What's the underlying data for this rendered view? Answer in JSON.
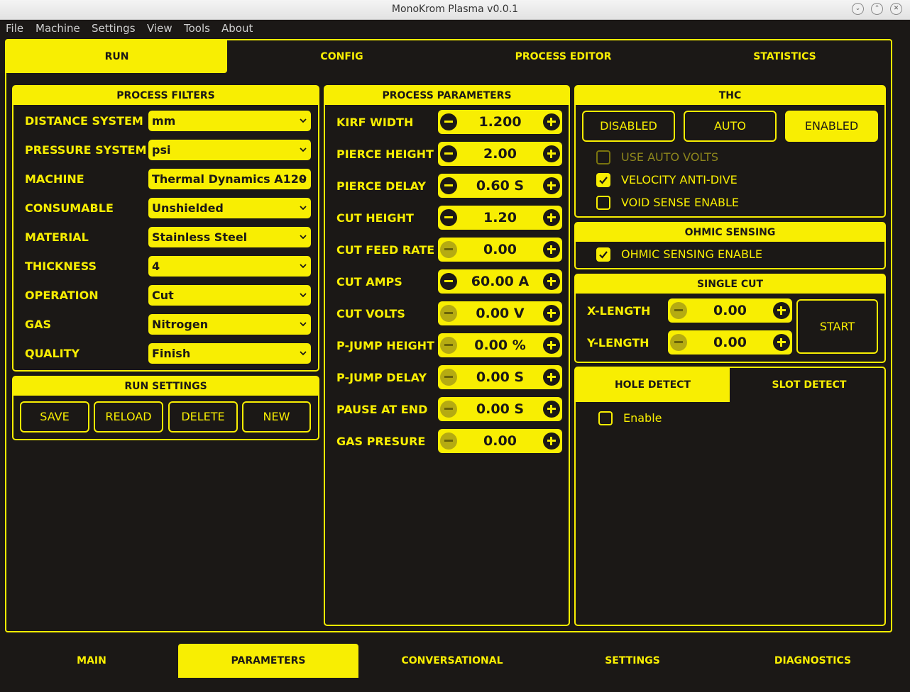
{
  "window": {
    "title": "MonoKrom Plasma v0.0.1"
  },
  "menu": [
    "File",
    "Machine",
    "Settings",
    "View",
    "Tools",
    "About"
  ],
  "top_tabs": [
    {
      "label": "RUN",
      "active": true
    },
    {
      "label": "CONFIG",
      "active": false
    },
    {
      "label": "PROCESS EDITOR",
      "active": false
    },
    {
      "label": "STATISTICS",
      "active": false
    }
  ],
  "process_filters": {
    "title": "PROCESS FILTERS",
    "fields": [
      {
        "label": "DISTANCE SYSTEM",
        "value": "mm"
      },
      {
        "label": "PRESSURE SYSTEM",
        "value": "psi"
      },
      {
        "label": "MACHINE",
        "value": "Thermal Dynamics A120"
      },
      {
        "label": "CONSUMABLE",
        "value": "Unshielded"
      },
      {
        "label": "MATERIAL",
        "value": "Stainless Steel"
      },
      {
        "label": "THICKNESS",
        "value": "4"
      },
      {
        "label": "OPERATION",
        "value": "Cut"
      },
      {
        "label": "GAS",
        "value": "Nitrogen"
      },
      {
        "label": "QUALITY",
        "value": "Finish"
      }
    ]
  },
  "run_settings": {
    "title": "RUN SETTINGS",
    "buttons": [
      "SAVE",
      "RELOAD",
      "DELETE",
      "NEW"
    ]
  },
  "process_parameters": {
    "title": "PROCESS PARAMETERS",
    "rows": [
      {
        "label": "KIRF WIDTH",
        "value": "1.200",
        "minus_enabled": true
      },
      {
        "label": "PIERCE HEIGHT",
        "value": "2.00",
        "minus_enabled": true
      },
      {
        "label": "PIERCE DELAY",
        "value": "0.60 S",
        "minus_enabled": true
      },
      {
        "label": "CUT HEIGHT",
        "value": "1.20",
        "minus_enabled": true
      },
      {
        "label": "CUT FEED RATE",
        "value": "0.00",
        "minus_enabled": false
      },
      {
        "label": "CUT AMPS",
        "value": "60.00 A",
        "minus_enabled": true
      },
      {
        "label": "CUT VOLTS",
        "value": "0.00 V",
        "minus_enabled": false
      },
      {
        "label": "P-JUMP HEIGHT",
        "value": "0.00 %",
        "minus_enabled": false
      },
      {
        "label": "P-JUMP DELAY",
        "value": "0.00 S",
        "minus_enabled": false
      },
      {
        "label": "PAUSE AT END",
        "value": "0.00 S",
        "minus_enabled": false
      },
      {
        "label": "GAS PRESURE",
        "value": "0.00",
        "minus_enabled": false
      }
    ]
  },
  "thc": {
    "title": "THC",
    "modes": [
      {
        "label": "DISABLED",
        "selected": false
      },
      {
        "label": "AUTO",
        "selected": false
      },
      {
        "label": "ENABLED",
        "selected": true
      }
    ],
    "checks": [
      {
        "label": "USE AUTO VOLTS",
        "checked": false,
        "disabled": true
      },
      {
        "label": "VELOCITY ANTI-DIVE",
        "checked": true,
        "disabled": false
      },
      {
        "label": "VOID SENSE ENABLE",
        "checked": false,
        "disabled": false
      }
    ]
  },
  "ohmic": {
    "title": "OHMIC SENSING",
    "check": {
      "label": "OHMIC SENSING ENABLE",
      "checked": true
    }
  },
  "single_cut": {
    "title": "SINGLE CUT",
    "x_label": "X-LENGTH",
    "x_value": "0.00",
    "y_label": "Y-LENGTH",
    "y_value": "0.00",
    "start_label": "START"
  },
  "detect": {
    "tabs": [
      {
        "label": "HOLE DETECT",
        "active": true
      },
      {
        "label": "SLOT DETECT",
        "active": false
      }
    ],
    "check": {
      "label": "Enable",
      "checked": false
    }
  },
  "bottom_tabs": [
    {
      "label": "MAIN",
      "active": false
    },
    {
      "label": "PARAMETERS",
      "active": true
    },
    {
      "label": "CONVERSATIONAL",
      "active": false
    },
    {
      "label": "SETTINGS",
      "active": false
    },
    {
      "label": "DIAGNOSTICS",
      "active": false
    }
  ],
  "colors": {
    "accent": "#f8ee02",
    "background": "#1b1816"
  }
}
